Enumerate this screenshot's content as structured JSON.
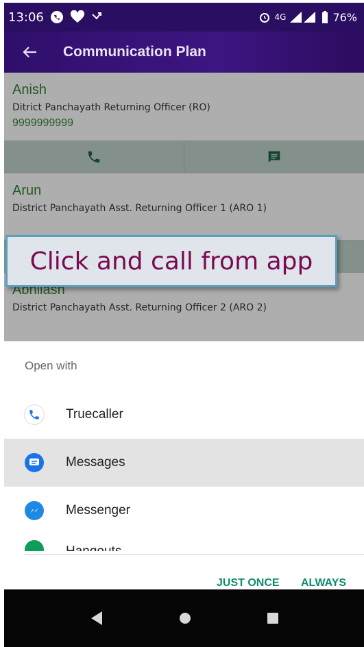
{
  "status_bar": {
    "time": "13:06",
    "network": "4G",
    "battery": "76%"
  },
  "toolbar": {
    "title": "Communication Plan",
    "back_icon": "arrow-back-icon"
  },
  "contacts": [
    {
      "name": "Anish",
      "role": "Ditrict Panchayath Returning Officer (RO)",
      "phone": "9999999999"
    },
    {
      "name": "Arun",
      "role": "District Panchayath Asst. Returning Officer 1 (ARO 1)",
      "phone": ""
    },
    {
      "name": "Abhilash",
      "role": "District Panchayath Asst. Returning Officer 2 (ARO 2)",
      "phone": ""
    }
  ],
  "callout": {
    "text": "Click and call from app"
  },
  "sheet": {
    "title": "Open with",
    "apps": [
      {
        "label": "Truecaller",
        "icon": "truecaller-icon"
      },
      {
        "label": "Messages",
        "icon": "messages-icon"
      },
      {
        "label": "Messenger",
        "icon": "messenger-icon"
      },
      {
        "label": "Hangouts",
        "icon": "hangouts-icon"
      }
    ],
    "just_once": "JUST ONCE",
    "always": "ALWAYS"
  },
  "colors": {
    "toolbar": "#2f0f6b",
    "accent_green": "#2e7d32",
    "button_teal": "#0d8a6e",
    "callout_text": "#7a0a52"
  }
}
